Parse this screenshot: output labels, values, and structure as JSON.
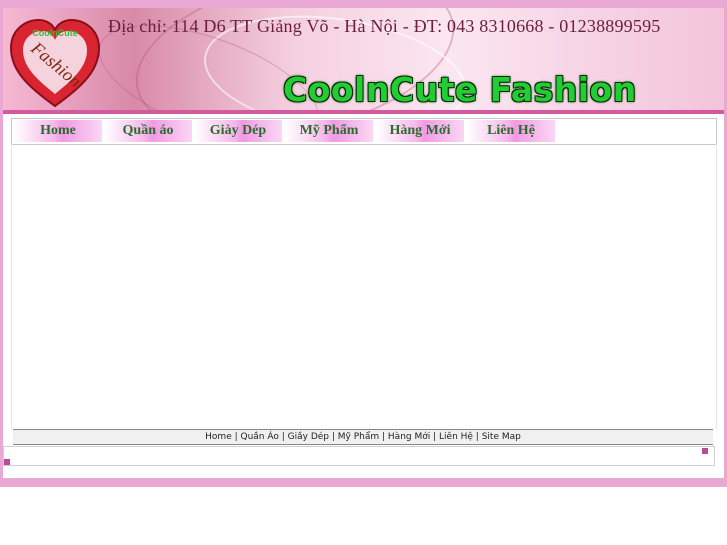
{
  "header": {
    "address": "Địa chỉ: 114 D6 TT Giảng Võ - Hà Nội - ĐT: 043 8310668 - 01238899595",
    "brand": "CoolnCute Fashion",
    "logo": {
      "top_text": "CoolnCute",
      "main_text": "Fashion",
      "icon": "heart-logo-icon"
    }
  },
  "nav": {
    "items": [
      {
        "label": "Home"
      },
      {
        "label": "Quần áo"
      },
      {
        "label": "Giày Dép"
      },
      {
        "label": "Mỹ Phẩm"
      },
      {
        "label": "Hàng Mới"
      },
      {
        "label": "Liên Hệ"
      }
    ]
  },
  "footer": {
    "links": [
      "Home",
      "Quần Áo",
      "Giầy Dép",
      "Mỹ Phẩm",
      "Hàng Mới",
      "Liên Hệ",
      "Site Map"
    ],
    "separator": " | "
  },
  "colors": {
    "frame": "#e9a9d4",
    "accent_line": "#d35aa0",
    "brand_green": "#22cc33",
    "nav_text": "#2b6b2b"
  }
}
